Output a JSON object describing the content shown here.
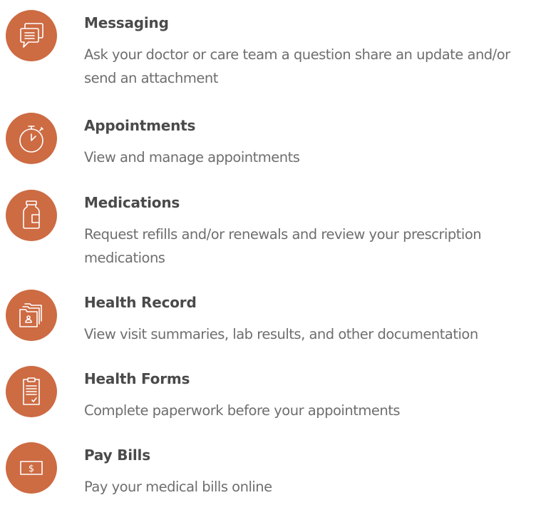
{
  "features": [
    {
      "icon": "chat-bubbles-icon",
      "title": "Messaging",
      "description": "Ask your doctor or care team a question share an update and/or send an attachment"
    },
    {
      "icon": "stopwatch-icon",
      "title": "Appointments",
      "description": "View and manage appointments"
    },
    {
      "icon": "medicine-bottle-icon",
      "title": "Medications",
      "description": "Request refills and/or renewals and review your prescription medications"
    },
    {
      "icon": "folder-record-icon",
      "title": "Health Record",
      "description": "View visit summaries, lab results, and other documentation"
    },
    {
      "icon": "clipboard-icon",
      "title": "Health Forms",
      "description": "Complete paperwork before your appointments"
    },
    {
      "icon": "bill-dollar-icon",
      "title": "Pay Bills",
      "description": "Pay your medical bills online"
    }
  ],
  "colors": {
    "icon_background": "#cd6b43",
    "icon_stroke": "#ffffff",
    "title_text": "#4a4a4a",
    "description_text": "#6e6e6e"
  }
}
